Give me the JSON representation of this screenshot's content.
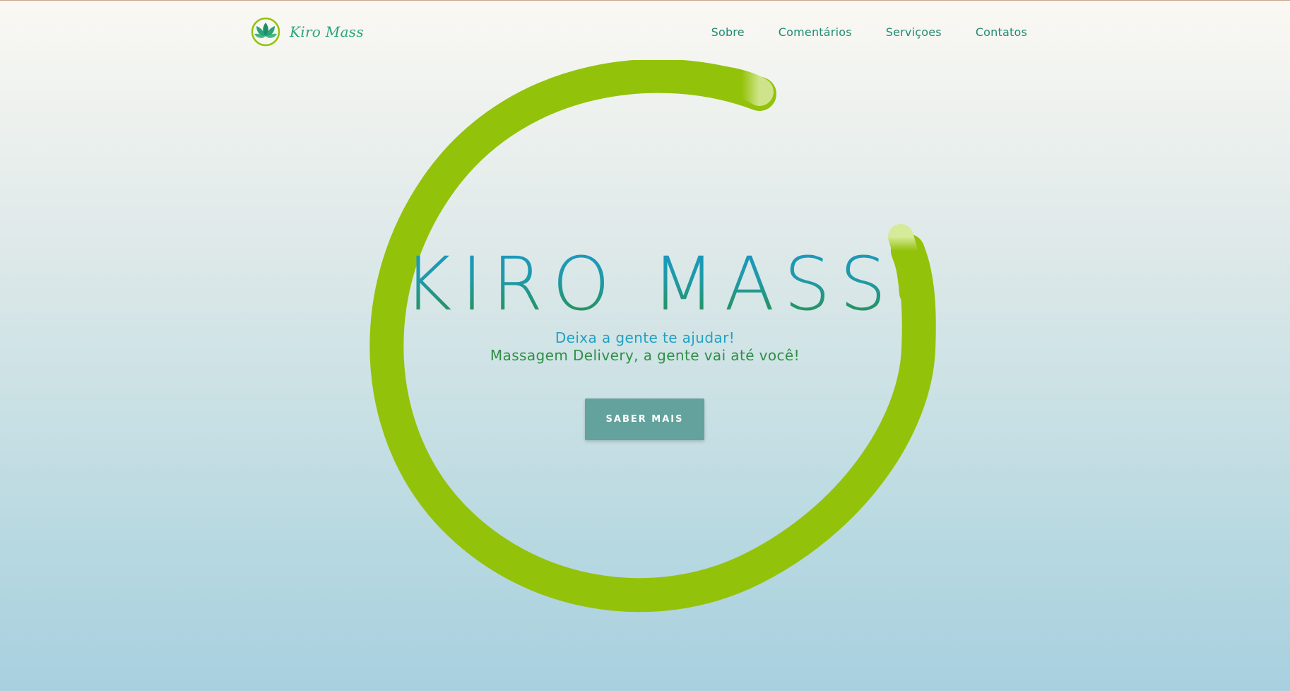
{
  "brand": {
    "name": "Kiro Mass",
    "logo_icon": "lotus-icon"
  },
  "nav": {
    "items": [
      {
        "label": "Sobre"
      },
      {
        "label": "Comentários"
      },
      {
        "label": "Serviçoes"
      },
      {
        "label": "Contatos"
      }
    ]
  },
  "hero": {
    "title": "KIRO MASS",
    "tagline_line1": "Deixa a gente te ajudar!",
    "tagline_line2": "Massagem Delivery, a gente vai até você!",
    "cta_label": "SABER MAIS"
  },
  "colors": {
    "ring": "#93c20a",
    "accent_teal": "#1f8a72",
    "button": "#64a29d",
    "title_top": "#1997c7",
    "title_bottom": "#2a8f3f"
  }
}
